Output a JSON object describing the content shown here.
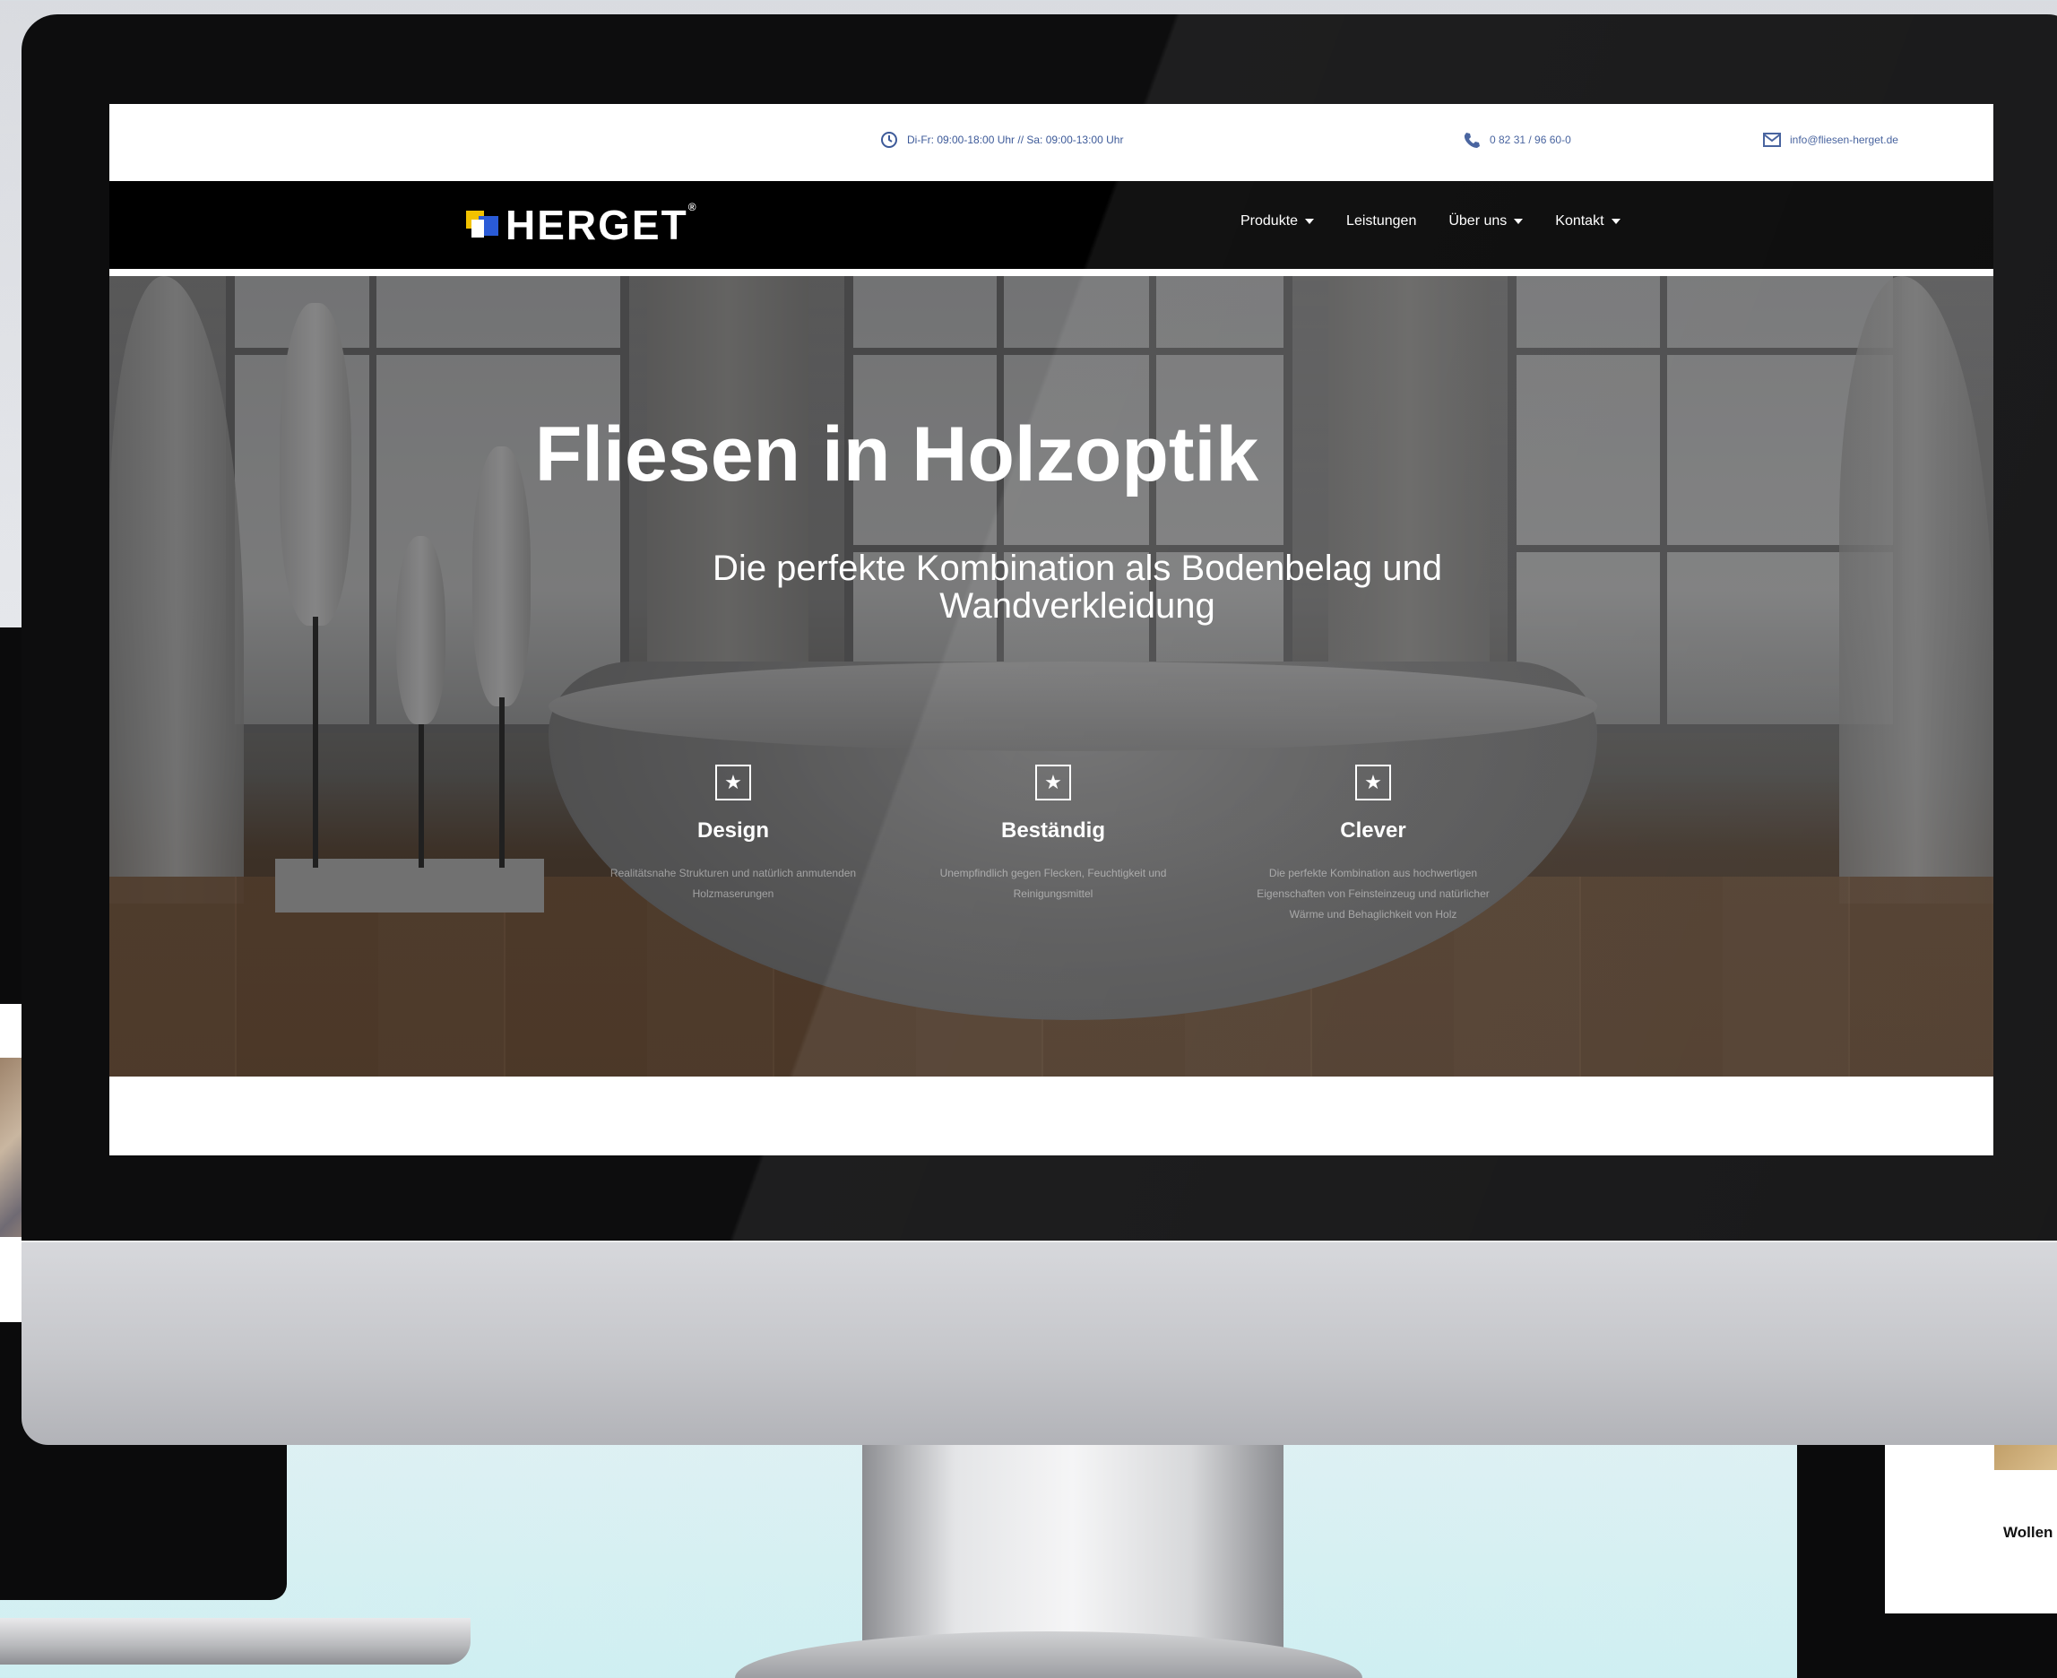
{
  "bg_tablet": {
    "label": "Wollen"
  },
  "topbar": {
    "hours": "Di-Fr: 09:00-18:00 Uhr // Sa: 09:00-13:00 Uhr",
    "phone": "0 82 31 / 96 60-0",
    "email": "info@fliesen-herget.de"
  },
  "brand": {
    "name": "HERGET",
    "mark": "®"
  },
  "nav": {
    "items": [
      {
        "label": "Produkte",
        "has_dropdown": true
      },
      {
        "label": "Leistungen",
        "has_dropdown": false
      },
      {
        "label": "Über uns",
        "has_dropdown": true
      },
      {
        "label": "Kontakt",
        "has_dropdown": true
      }
    ]
  },
  "hero": {
    "title": "Fliesen in Holzoptik",
    "subtitle": "Die perfekte Kombination als Bodenbelag und Wandverkleidung"
  },
  "features": [
    {
      "icon": "star-icon",
      "title": "Design",
      "desc": "Realitätsnahe Strukturen und natürlich anmutenden Holzmaserungen"
    },
    {
      "icon": "star-icon",
      "title": "Beständig",
      "desc": "Unempfindlich gegen Flecken, Feuchtigkeit und Reinigungsmittel"
    },
    {
      "icon": "star-icon",
      "title": "Clever",
      "desc": "Die perfekte Kombination aus hochwertigen Eigenschaften von Feinsteinzeug und natürlicher Wärme und Behaglichkeit von Holz"
    }
  ],
  "colors": {
    "accent": "#2f4f9a",
    "logo_yellow": "#f2c200",
    "logo_blue": "#2a5bd7"
  }
}
